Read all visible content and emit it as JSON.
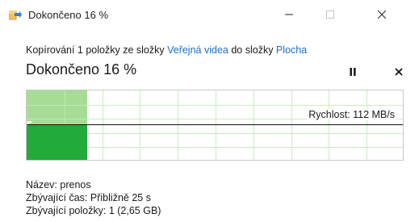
{
  "window": {
    "title": "Dokončeno 16 %",
    "icon": "copy-files-icon"
  },
  "copy": {
    "prefix": "Kopírování 1 položky ze složky ",
    "source_folder": "Veřejná videa",
    "middle": " do složky ",
    "destination_folder": "Plocha",
    "status": "Dokončeno 16 %",
    "percent_complete": 16
  },
  "controls": {
    "pause_icon": "pause-icon",
    "cancel_icon": "close-icon"
  },
  "graph": {
    "speed_text": "Rychlost: 112 MB/s",
    "progress_color": "#22aa3a",
    "progress_light_color": "#a6dc96",
    "grid_color": "#c8ecc0"
  },
  "details": {
    "name_label": "Název:",
    "name_value": "prenos",
    "time_label": "Zbývající čas:",
    "time_value": "Přibližně 25 s",
    "items_label": "Zbývající položky:",
    "items_value": "1 (2,65 GB)"
  }
}
